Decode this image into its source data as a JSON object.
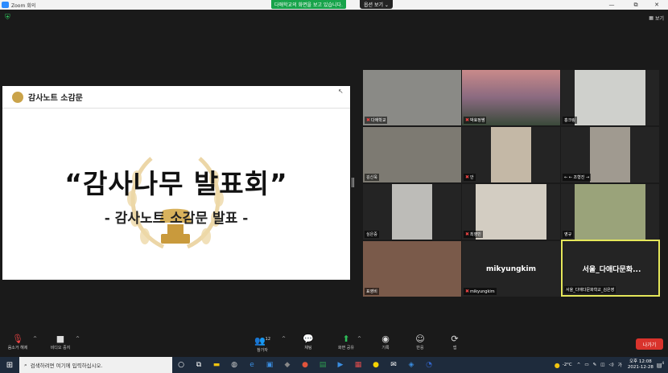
{
  "window": {
    "title": "Zoom 회의"
  },
  "banner": {
    "sharing_text": "다애학교의 화면을 보고 있습니다.",
    "view_options": "옵션 보기 ⌄"
  },
  "window_controls": {
    "minimize": "—",
    "restore": "⧉",
    "maximize": "☐",
    "close": "✕"
  },
  "top_right": {
    "view_label": "보기"
  },
  "slide": {
    "header_title": "감사노트 소감문",
    "title": "“감사나무 발표회”",
    "subtitle": "- 감사노트 소감문 발표 -"
  },
  "participants": [
    {
      "name": "다애학교"
    },
    {
      "name": "박효정쌤"
    },
    {
      "name": "홍크링"
    },
    {
      "name": "김신욱"
    },
    {
      "name": "안"
    },
    {
      "name": "← ← 조형진 →"
    },
    {
      "name": "심은중"
    },
    {
      "name": "최영빈"
    },
    {
      "name": "영규"
    },
    {
      "name": "표영비"
    },
    {
      "name": "mikyungkim",
      "big": "mikyungkim"
    },
    {
      "name": "서울_다애다문화학교_김은영",
      "big": "서울_다애다문화..."
    }
  ],
  "toolbar": {
    "unmute": "음소거 해제",
    "stop_video": "비디오 중지",
    "participants": "참가자",
    "participants_count": "12",
    "chat": "채팅",
    "share_screen": "화면 공유",
    "record": "기록",
    "reactions": "반응",
    "apps": "앱",
    "leave": "나가기"
  },
  "taskbar": {
    "search_placeholder": "검색하려면 여기에 입력하십시오.",
    "temperature": "-2°C",
    "lang": "가",
    "time_ampm": "오후 12:08",
    "date": "2021-12-28",
    "notif_count": "4"
  },
  "colors": {
    "leave": "#d9332c",
    "share_banner": "#17a34a",
    "active_speaker": "#e5e75a",
    "zoom_blue": "#2d8cff"
  }
}
